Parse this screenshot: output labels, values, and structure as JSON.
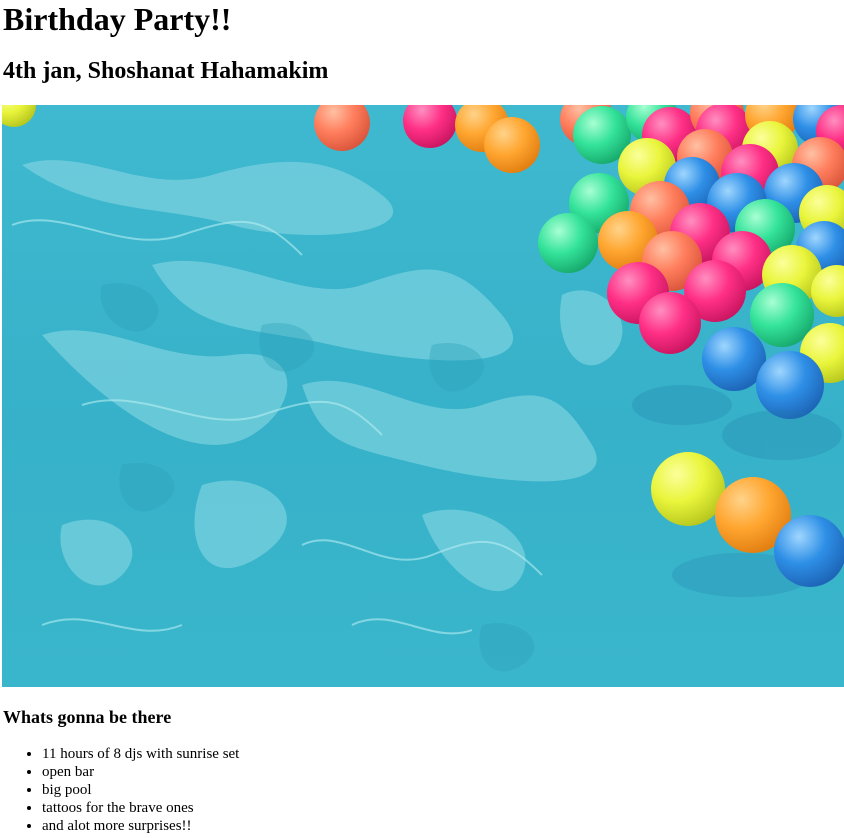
{
  "title": "Birthday Party!!",
  "subtitle": "4th jan, Shoshanat Hahamakim",
  "hero_image": {
    "icon": "pool-with-floating-balls-image",
    "colors": {
      "water": "#3bb6cf",
      "water_light": "#8fdbe6",
      "ball_pink": "#ff2f86",
      "ball_orange": "#ffa630",
      "ball_yellow": "#e9f53b",
      "ball_green": "#34e39a",
      "ball_blue": "#2e8fe6"
    }
  },
  "section_heading": "Whats gonna be there",
  "items": [
    "11 hours of 8 djs with sunrise set",
    "open bar",
    "big pool",
    "tattoos for the brave ones",
    "and alot more surprises!!"
  ]
}
